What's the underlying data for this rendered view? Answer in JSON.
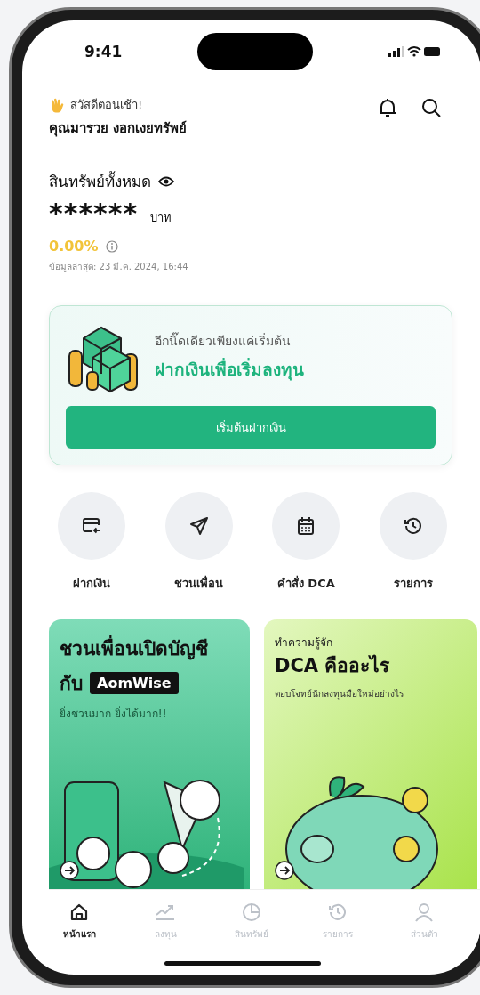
{
  "status_bar": {
    "time": "9:41"
  },
  "greeting": {
    "text": "สวัสดีตอนเช้า!",
    "name": "คุณมารวย งอกเงยทรัพย์"
  },
  "assets": {
    "label": "สินทรัพย์ทั้งหมด",
    "value": "******",
    "unit": "บาท",
    "change": "0.00%",
    "updated": "ข้อมูลล่าสุด: 23 มี.ค. 2024, 16:44"
  },
  "deposit_card": {
    "subtitle": "อีกนิ๊ดเดียวเพียงแค่เริ่มต้น",
    "title": "ฝากเงินเพื่อเริ่มลงทุน",
    "button": "เริ่มต้นฝากเงิน"
  },
  "quick_actions": [
    {
      "kind": "deposit",
      "label": "ฝากเงิน"
    },
    {
      "kind": "invite",
      "label": "ชวนเพื่อน"
    },
    {
      "kind": "dca",
      "label": "คำสั่ง DCA"
    },
    {
      "kind": "history",
      "label": "รายการ"
    }
  ],
  "banners": [
    {
      "kind": "invite",
      "title": "ชวนเพื่อนเปิดบัญชี",
      "prefix": "กับ",
      "brand": "AomWise",
      "subtitle": "ยิ่งชวนมาก ยิ่งได้มาก!!"
    },
    {
      "kind": "learn",
      "eyebrow": "ทำความรู้จัก",
      "title": "DCA คืออะไร",
      "subtitle": "ตอบโจทย์นักลงทุนมือใหม่อย่างไร"
    }
  ],
  "tab_bar": [
    {
      "kind": "home",
      "label": "หน้าแรก",
      "selected": true
    },
    {
      "kind": "invest",
      "label": "ลงทุน",
      "selected": false
    },
    {
      "kind": "portfolio",
      "label": "สินทรัพย์",
      "selected": false
    },
    {
      "kind": "history",
      "label": "รายการ",
      "selected": false
    },
    {
      "kind": "profile",
      "label": "ส่วนตัว",
      "selected": false
    }
  ]
}
